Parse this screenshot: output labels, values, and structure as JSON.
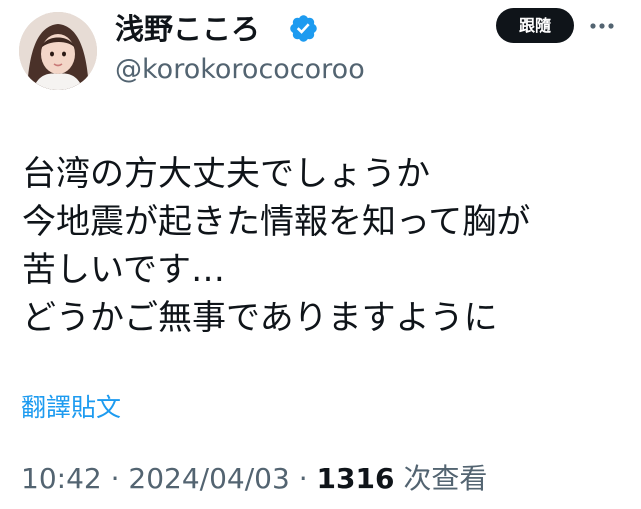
{
  "author": {
    "display_name": "浅野こころ",
    "handle": "@korokorococoroo",
    "verified_icon": "verified-badge-icon",
    "avatar_icon": "profile-photo"
  },
  "header": {
    "follow_label": "跟隨",
    "more_icon": "more-options-icon"
  },
  "tweet": {
    "lines": [
      "台湾の方大丈夫でしょうか",
      "今地震が起きた情報を知って胸が",
      "苦しいです…",
      "どうかご無事でありますように"
    ]
  },
  "translate": {
    "label": "翻譯貼文"
  },
  "meta": {
    "time": "10:42",
    "separator": " · ",
    "date": "2024/04/03",
    "views_count": "1316",
    "views_label": "次查看"
  },
  "colors": {
    "accent": "#1d9bf0",
    "text": "#0f1419",
    "muted": "#536471",
    "button_bg": "#0f1419"
  }
}
